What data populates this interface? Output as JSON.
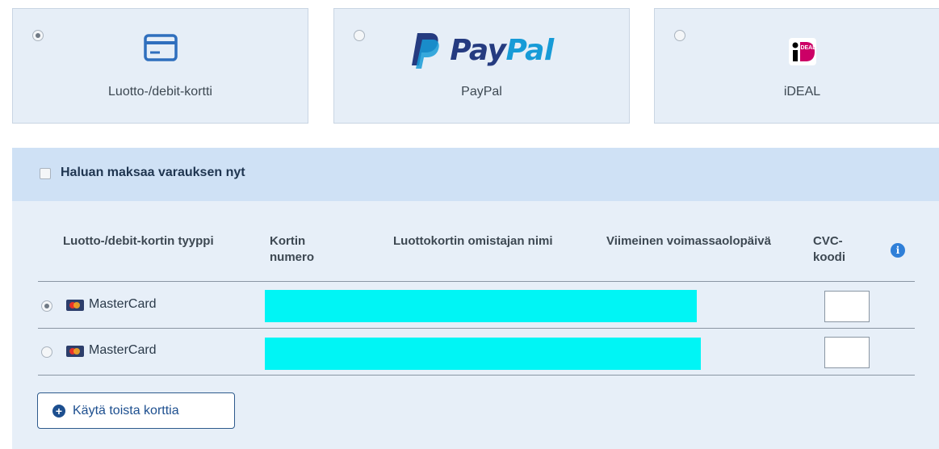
{
  "payment_methods": [
    {
      "label": "Luotto-/debit-kortti",
      "icon": "credit-card-icon",
      "selected": true
    },
    {
      "label": "PayPal",
      "logo_text_a": "Pay",
      "logo_text_b": "Pal",
      "icon": "paypal-logo",
      "selected": false
    },
    {
      "label": "iDEAL",
      "icon": "ideal-logo",
      "logo_text": "iDEAL",
      "selected": false
    }
  ],
  "pay_now": {
    "label": "Haluan maksaa varauksen nyt",
    "checked": false
  },
  "card_table": {
    "headers": {
      "card_type": "Luotto-/debit-kortin tyyppi",
      "card_number": "Kortin numero",
      "holder_name": "Luottokortin omistajan nimi",
      "expiry": "Viimeinen voimassaolopäivä",
      "cvc": "CVC-koodi"
    },
    "rows": [
      {
        "card_type": "MasterCard",
        "selected": true,
        "cvc": ""
      },
      {
        "card_type": "MasterCard",
        "selected": false,
        "cvc": ""
      }
    ]
  },
  "use_other_card": {
    "label": "Käytä toista korttia"
  },
  "colors": {
    "accent": "#1d4f8f",
    "panel": "#e7eff8",
    "bar": "#cfe1f5",
    "redaction": "#00f5f5"
  }
}
